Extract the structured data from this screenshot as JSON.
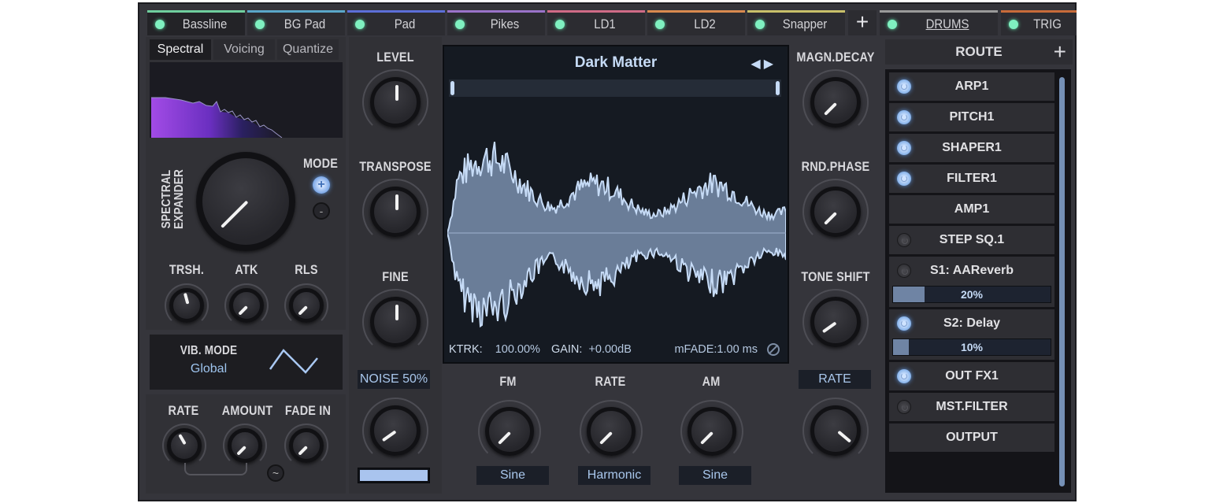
{
  "tabs": [
    {
      "label": "Bassline",
      "color": "#6fcf9e",
      "active": true
    },
    {
      "label": "BG Pad",
      "color": "#5aa7c9"
    },
    {
      "label": "Pad",
      "color": "#5c6fd8"
    },
    {
      "label": "Pikes",
      "color": "#9a73c9"
    },
    {
      "label": "LD1",
      "color": "#cf6b86"
    },
    {
      "label": "LD2",
      "color": "#d98a4f"
    },
    {
      "label": "Snapper",
      "color": "#c9c06a"
    },
    {
      "label": "DRUMS",
      "color": "#9a9a9a"
    },
    {
      "label": "TRIG",
      "color": "#c86b3a"
    }
  ],
  "tab_add_label": "+",
  "subtabs": [
    "Spectral",
    "Voicing",
    "Quantize"
  ],
  "spectral": {
    "expander_label_1": "SPECTRAL",
    "expander_label_2": "EXPANDER",
    "mode_label": "MODE",
    "mode_plus": "+",
    "mode_minus": "-",
    "knobs": [
      "TRSH.",
      "ATK",
      "RLS"
    ]
  },
  "vibrato": {
    "mode_title": "VIB. MODE",
    "mode_value": "Global",
    "knobs": [
      "RATE",
      "AMOUNT",
      "FADE IN"
    ],
    "sync_icon": "~"
  },
  "osc_knobs": [
    "LEVEL",
    "TRANSPOSE",
    "FINE"
  ],
  "noise": {
    "label": "NOISE 50%",
    "value_percent": 50
  },
  "wavetable": {
    "name": "Dark Matter",
    "prev": "◀",
    "next": "▶",
    "ktrk_label": "KTRK:",
    "ktrk_value": "100.00%",
    "gain_label": "GAIN:",
    "gain_value": "+0.00dB",
    "mfade": "mFADE:1.00 ms"
  },
  "mod_knobs": [
    {
      "label": "FM",
      "mode": "Sine"
    },
    {
      "label": "RATE",
      "mode": "Harmonic"
    },
    {
      "label": "AM",
      "mode": "Sine"
    }
  ],
  "right_knobs": [
    "MAGN.DECAY",
    "RND.PHASE",
    "TONE SHIFT"
  ],
  "right_rate_label": "RATE",
  "route": {
    "title": "ROUTE",
    "add": "+",
    "items": [
      {
        "label": "ARP1",
        "power": "on"
      },
      {
        "label": "PITCH1",
        "power": "on"
      },
      {
        "label": "SHAPER1",
        "power": "on"
      },
      {
        "label": "FILTER1",
        "power": "on"
      },
      {
        "label": "AMP1",
        "power": "none"
      },
      {
        "label": "STEP SQ.1",
        "power": "off"
      },
      {
        "label": "S1: AAReverb",
        "power": "off",
        "send": "20%",
        "send_fraction": 0.2
      },
      {
        "label": "S2: Delay",
        "power": "on",
        "send": "10%",
        "send_fraction": 0.1
      },
      {
        "label": "OUT FX1",
        "power": "on"
      },
      {
        "label": "MST.FILTER",
        "power": "off"
      },
      {
        "label": "OUTPUT",
        "power": "none"
      }
    ]
  }
}
